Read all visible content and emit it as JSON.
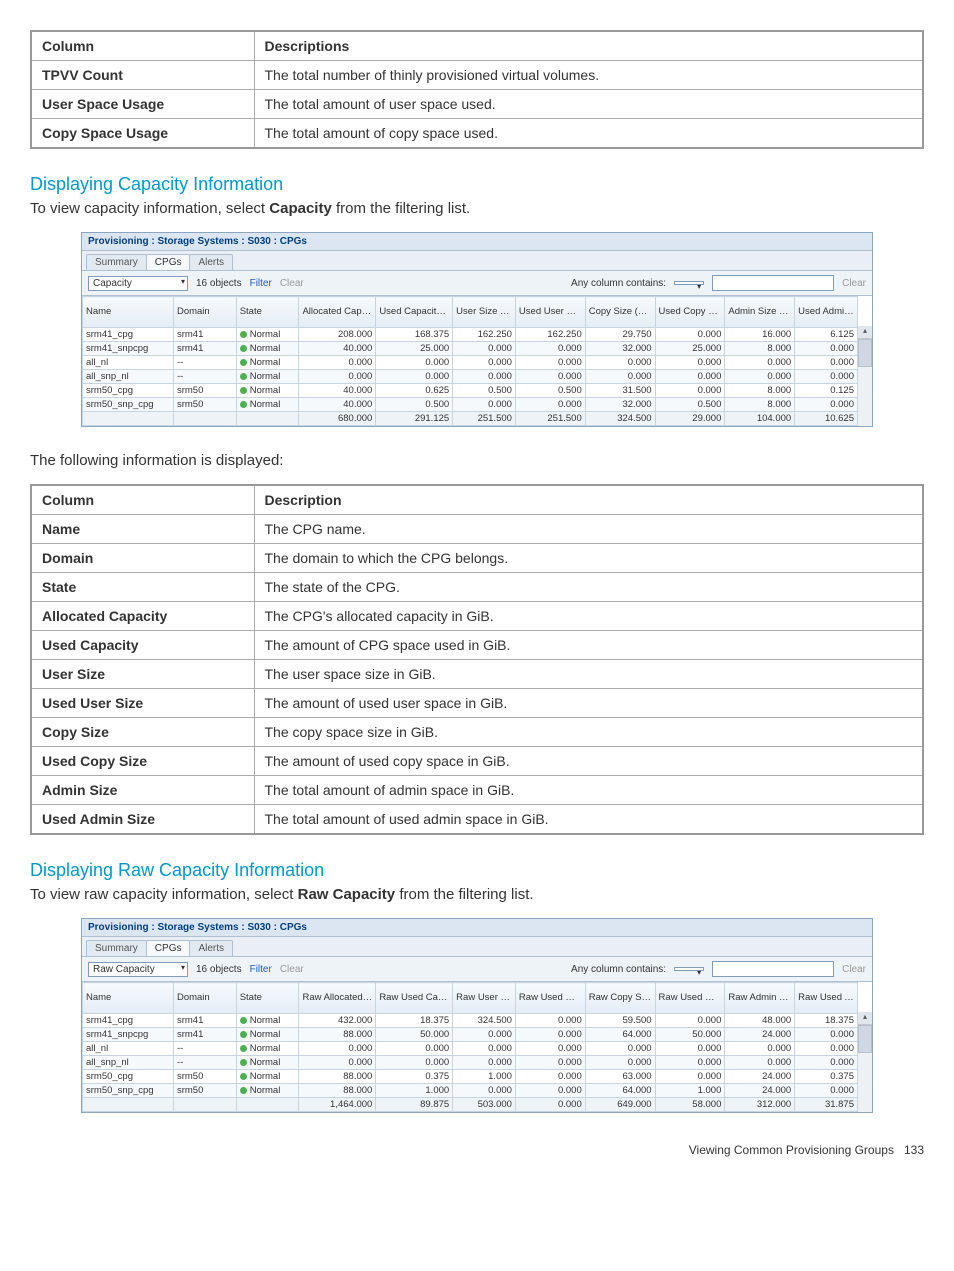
{
  "topTable": {
    "headers": [
      "Column",
      "Descriptions"
    ],
    "rows": [
      [
        "TPVV Count",
        "The total number of thinly provisioned virtual volumes."
      ],
      [
        "User Space Usage",
        "The total amount of user space used."
      ],
      [
        "Copy Space Usage",
        "The total amount of copy space used."
      ]
    ]
  },
  "section1": {
    "heading": "Displaying Capacity Information",
    "intro_pre": "To view capacity information, select ",
    "intro_bold": "Capacity",
    "intro_post": " from the filtering list."
  },
  "screenshot1": {
    "title": "Provisioning : Storage Systems : S030 : CPGs",
    "tabs": [
      "Summary",
      "CPGs",
      "Alerts"
    ],
    "filterValue": "Capacity",
    "objectCount": "16 objects",
    "filterBtn": "Filter",
    "clearBtn": "Clear",
    "anyColLabel": "Any column contains:",
    "clearRight": "Clear",
    "columns": [
      "Name",
      "Domain",
      "State",
      "Allocated Capacity (GB)",
      "Used Capacity (GB)",
      "User Size (GB)",
      "Used User Size (GB)",
      "Copy Size (GB)",
      "Used Copy Size (GB)",
      "Admin Size (GB)",
      "Used Admin Size (GB)"
    ],
    "rows": [
      [
        "srm41_cpg",
        "srm41",
        "Normal",
        "208.000",
        "168.375",
        "162.250",
        "162.250",
        "29.750",
        "0.000",
        "16.000",
        "6.125"
      ],
      [
        "srm41_snpcpg",
        "srm41",
        "Normal",
        "40.000",
        "25.000",
        "0.000",
        "0.000",
        "32.000",
        "25.000",
        "8.000",
        "0.000"
      ],
      [
        "all_nl",
        "--",
        "Normal",
        "0.000",
        "0.000",
        "0.000",
        "0.000",
        "0.000",
        "0.000",
        "0.000",
        "0.000"
      ],
      [
        "all_snp_nl",
        "--",
        "Normal",
        "0.000",
        "0.000",
        "0.000",
        "0.000",
        "0.000",
        "0.000",
        "0.000",
        "0.000"
      ],
      [
        "srm50_cpg",
        "srm50",
        "Normal",
        "40.000",
        "0.625",
        "0.500",
        "0.500",
        "31.500",
        "0.000",
        "8.000",
        "0.125"
      ],
      [
        "srm50_snp_cpg",
        "srm50",
        "Normal",
        "40.000",
        "0.500",
        "0.000",
        "0.000",
        "32.000",
        "0.500",
        "8.000",
        "0.000"
      ]
    ],
    "totals": [
      "",
      "",
      "",
      "680.000",
      "291.125",
      "251.500",
      "251.500",
      "324.500",
      "29.000",
      "104.000",
      "10.625"
    ]
  },
  "midText": "The following information is displayed:",
  "descTable": {
    "headers": [
      "Column",
      "Description"
    ],
    "rows": [
      [
        "Name",
        "The CPG name."
      ],
      [
        "Domain",
        "The domain to which the CPG belongs."
      ],
      [
        "State",
        "The state of the CPG."
      ],
      [
        "Allocated Capacity",
        "The CPG's allocated capacity in GiB."
      ],
      [
        "Used Capacity",
        "The amount of CPG space used in GiB."
      ],
      [
        "User Size",
        "The user space size in GiB."
      ],
      [
        "Used User Size",
        "The amount of used user space in GiB."
      ],
      [
        "Copy Size",
        "The copy space size in GiB."
      ],
      [
        "Used Copy Size",
        "The amount of used copy space in GiB."
      ],
      [
        "Admin Size",
        "The total amount of admin space in GiB."
      ],
      [
        "Used Admin Size",
        "The total amount of used admin space in GiB."
      ]
    ]
  },
  "section2": {
    "heading": "Displaying Raw Capacity Information",
    "intro_pre": "To view raw capacity information, select ",
    "intro_bold": "Raw Capacity",
    "intro_post": " from the filtering list."
  },
  "screenshot2": {
    "title": "Provisioning : Storage Systems : S030 : CPGs",
    "tabs": [
      "Summary",
      "CPGs",
      "Alerts"
    ],
    "filterValue": "Raw Capacity",
    "objectCount": "16 objects",
    "filterBtn": "Filter",
    "clearBtn": "Clear",
    "anyColLabel": "Any column contains:",
    "clearRight": "Clear",
    "columns": [
      "Name",
      "Domain",
      "State",
      "Raw Allocated Capacity (GB)",
      "Raw Used Capacity (GB)",
      "Raw User Size (GB)",
      "Raw Used User Size (GB)",
      "Raw Copy Size (GB)",
      "Raw Used Copy Size (GB)",
      "Raw Admin Size (GB)",
      "Raw Used Admin Size (GB)"
    ],
    "rows": [
      [
        "srm41_cpg",
        "srm41",
        "Normal",
        "432.000",
        "18.375",
        "324.500",
        "0.000",
        "59.500",
        "0.000",
        "48.000",
        "18.375"
      ],
      [
        "srm41_snpcpg",
        "srm41",
        "Normal",
        "88.000",
        "50.000",
        "0.000",
        "0.000",
        "64.000",
        "50.000",
        "24.000",
        "0.000"
      ],
      [
        "all_nl",
        "--",
        "Normal",
        "0.000",
        "0.000",
        "0.000",
        "0.000",
        "0.000",
        "0.000",
        "0.000",
        "0.000"
      ],
      [
        "all_snp_nl",
        "--",
        "Normal",
        "0.000",
        "0.000",
        "0.000",
        "0.000",
        "0.000",
        "0.000",
        "0.000",
        "0.000"
      ],
      [
        "srm50_cpg",
        "srm50",
        "Normal",
        "88.000",
        "0.375",
        "1.000",
        "0.000",
        "63.000",
        "0.000",
        "24.000",
        "0.375"
      ],
      [
        "srm50_snp_cpg",
        "srm50",
        "Normal",
        "88.000",
        "1.000",
        "0.000",
        "0.000",
        "64.000",
        "1.000",
        "24.000",
        "0.000"
      ]
    ],
    "totals": [
      "",
      "",
      "",
      "1,464.000",
      "89.875",
      "503.000",
      "0.000",
      "649.000",
      "58.000",
      "312.000",
      "31.875"
    ]
  },
  "footer": {
    "section": "Viewing Common Provisioning Groups",
    "page": "133"
  }
}
